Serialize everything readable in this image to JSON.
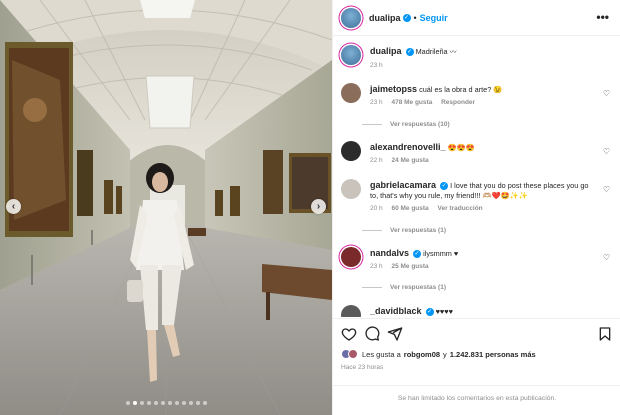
{
  "post": {
    "author": "dualipa",
    "follow_label": "Seguir",
    "caption": "Madrileña",
    "caption_time": "23 h",
    "likes_prefix": "Les gusta a",
    "likes_user": "robgom08",
    "likes_connector": "y",
    "likes_count": "1.242.831 personas más",
    "posted_ago": "Hace 23 horas",
    "comments_limited": "Se han limitado los comentarios en esta publicación.",
    "carousel_slides": 12,
    "carousel_active": 1
  },
  "comments": [
    {
      "user": "jaimetopss",
      "verified": false,
      "text": "cuál es la obra d arte? 😉",
      "time": "23 h",
      "likes": "478 Me gusta",
      "extra": "",
      "replies": "Ver respuestas (10)",
      "avatar_color": "#8a6d5a"
    },
    {
      "user": "alexandrenovelli_",
      "verified": false,
      "text": "😍😍😍",
      "time": "22 h",
      "likes": "24 Me gusta",
      "extra": "",
      "replies": "",
      "avatar_color": "#2b2b2b"
    },
    {
      "user": "gabrielacamara",
      "verified": true,
      "text": "I love that you do post these places you go to, that's why you rule, my friend!!! 🫶🏼❤️🤩✨✨",
      "time": "20 h",
      "likes": "60 Me gusta",
      "extra": "Ver traducción",
      "replies": "Ver respuestas (1)",
      "avatar_color": "#c9c3bc"
    },
    {
      "user": "nandalvs",
      "verified": true,
      "text": "ilysmmm ♥",
      "time": "23 h",
      "likes": "25 Me gusta",
      "extra": "",
      "replies": "Ver respuestas (1)",
      "avatar_color": "#7a2a2a"
    },
    {
      "user": "_davidblack",
      "verified": true,
      "text": "♥♥♥♥",
      "time": "",
      "likes": "",
      "extra": "",
      "replies": "",
      "avatar_color": "#5a5a5a"
    }
  ],
  "icons": {
    "heart": "heart-icon",
    "comment": "comment-icon",
    "share": "share-icon",
    "save": "bookmark-icon",
    "more": "more-options-icon",
    "verified": "verified-badge-icon"
  },
  "colors": {
    "accent": "#0095f6",
    "muted": "#8e8e8e",
    "text": "#262626"
  }
}
